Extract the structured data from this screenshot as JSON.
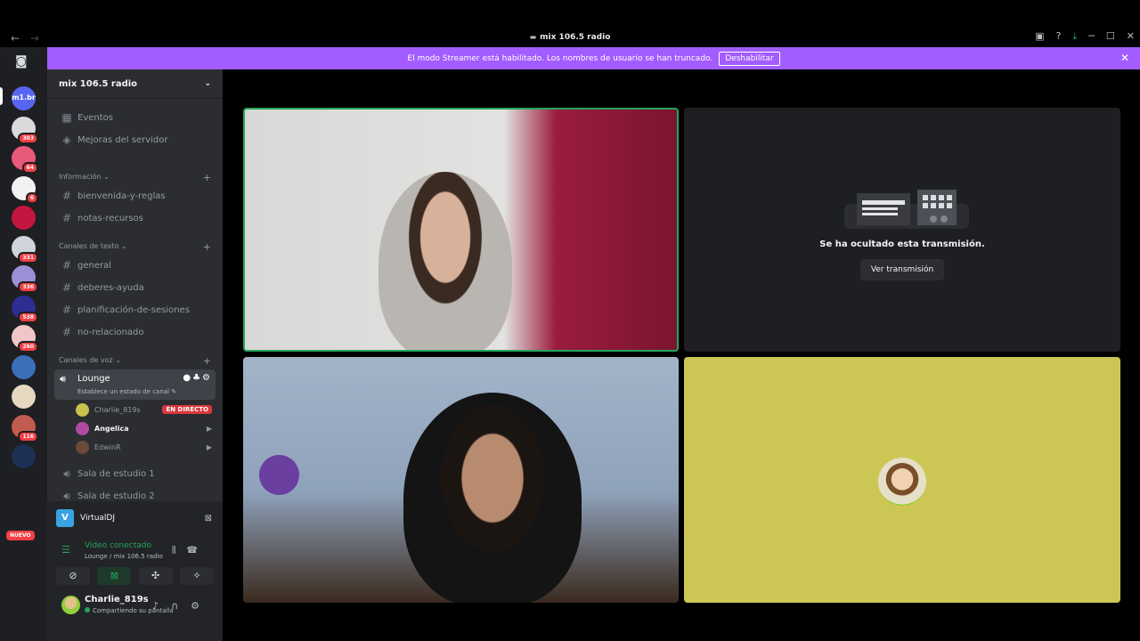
{
  "titlebar": {
    "title": "mix 106.5 radio",
    "back": "←",
    "forward": "→",
    "icons": [
      "inbox-icon",
      "help-icon",
      "download-icon",
      "minimize-icon",
      "maximize-icon",
      "close-icon"
    ],
    "ctrl_glyphs": [
      "▣",
      "?",
      "⤓",
      "─",
      "☐",
      "✕"
    ]
  },
  "banner": {
    "text": "El modo Streamer está habilitado. Los nombres de usuario se han truncado.",
    "button": "Deshabilitar",
    "color": "#a35cff"
  },
  "guilds": {
    "items": [
      {
        "label": "m1.br",
        "color": "#5865f2",
        "badge": ""
      },
      {
        "label": "",
        "color": "#d9dadc",
        "badge": "303"
      },
      {
        "label": "",
        "color": "#e8597a",
        "badge": "64"
      },
      {
        "label": "",
        "color": "#f2f2f2",
        "badge": "6"
      },
      {
        "label": "",
        "color": "#c3173f",
        "badge": ""
      },
      {
        "label": "",
        "color": "#cfd3dc",
        "badge": "331"
      },
      {
        "label": "",
        "color": "#9b8fd6",
        "badge": "336"
      },
      {
        "label": "",
        "color": "#2d2e91",
        "badge": "538"
      },
      {
        "label": "",
        "color": "#f1c6c9",
        "badge": "260"
      },
      {
        "label": "",
        "color": "#3b6fb8",
        "badge": ""
      },
      {
        "label": "",
        "color": "#e5d7c0",
        "badge": ""
      },
      {
        "label": "",
        "color": "#c25b4f",
        "badge": "116"
      },
      {
        "label": "",
        "color": "#1c2f54",
        "badge": ""
      }
    ],
    "new_label": "NUEVO"
  },
  "sidebar": {
    "server_name": "mix 106.5 radio",
    "top_items": [
      {
        "icon": "calendar-icon",
        "label": "Eventos"
      },
      {
        "icon": "boost-icon",
        "label": "Mejoras del servidor"
      }
    ],
    "info_category": "Información",
    "info_channels": [
      "bienvenida-y-reglas",
      "notas-recursos"
    ],
    "text_category": "Canales de texto",
    "text_channels": [
      "general",
      "deberes-ayuda",
      "planificación-de-sesiones",
      "no-relacionado"
    ],
    "voice_category": "Canales de voz",
    "lounge": {
      "name": "Lounge",
      "status": "Establece un estado de canal",
      "users": [
        {
          "name": "Charlie_819s",
          "badge": "EN DIRECTO",
          "color": "#c7c24d"
        },
        {
          "name": "Angelica",
          "badge": "",
          "color": "#b04ca0"
        },
        {
          "name": "EdwinR",
          "badge": "",
          "color": "#6b4a3a"
        }
      ]
    },
    "other_voice": [
      "Sala de estudio 1",
      "Sala de estudio 2"
    ]
  },
  "panel": {
    "activity": "VirtualDJ",
    "voice_title": "Video conectado",
    "voice_sub": "Lounge / mix 106.5 radio",
    "user_name": "Charlie_819s",
    "user_status": "Compartiendo su pantalla"
  },
  "stage": {
    "hidden_title": "Se ha ocultado esta transmisión.",
    "hidden_button": "Ver transmisión",
    "accent_color": "#ccc754"
  }
}
